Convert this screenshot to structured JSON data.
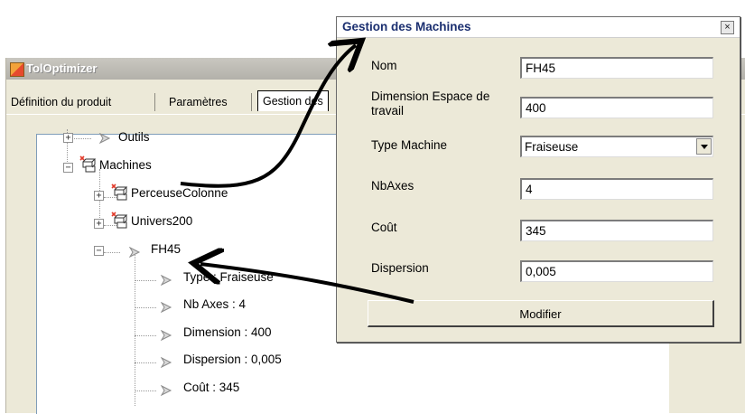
{
  "main_window": {
    "title": "TolOptimizer",
    "tabs": [
      {
        "label": "Définition du produit"
      },
      {
        "label": "Paramètres"
      },
      {
        "label": "Gestion des"
      }
    ]
  },
  "tree": {
    "nodes": [
      {
        "label": "Outils",
        "expander": "+",
        "icon": "arrow-icon"
      },
      {
        "label": "Machines",
        "expander": "−",
        "icon": "machine-group-icon"
      },
      {
        "label": "PerceuseColonne",
        "expander": "+",
        "icon": "machine-icon"
      },
      {
        "label": "Univers200",
        "expander": "+",
        "icon": "machine-icon"
      },
      {
        "label": "FH45",
        "expander": "−",
        "icon": "arrow-icon"
      },
      {
        "label": "Type : Fraiseuse",
        "icon": "arrow-icon"
      },
      {
        "label": "Nb Axes : 4",
        "icon": "arrow-icon"
      },
      {
        "label": "Dimension : 400",
        "icon": "arrow-icon"
      },
      {
        "label": "Dispersion : 0,005",
        "icon": "arrow-icon"
      },
      {
        "label": "Coût : 345",
        "icon": "arrow-icon"
      }
    ]
  },
  "dialog": {
    "title": "Gestion des Machines",
    "close_label": "×",
    "fields": {
      "nom": {
        "label": "Nom",
        "value": "FH45"
      },
      "dimension": {
        "label": "Dimension Espace de travail",
        "value": "400"
      },
      "type_machine": {
        "label": "Type Machine",
        "value": "Fraiseuse"
      },
      "nbaxes": {
        "label": "NbAxes",
        "value": "4"
      },
      "cout": {
        "label": "Coût",
        "value": "345"
      },
      "dispersion": {
        "label": "Dispersion",
        "value": "0,005"
      }
    },
    "submit_label": "Modifier"
  },
  "colors": {
    "dialog_title": "#1b2f70",
    "window_bg": "#ece9d8",
    "arrow": "#000000"
  }
}
